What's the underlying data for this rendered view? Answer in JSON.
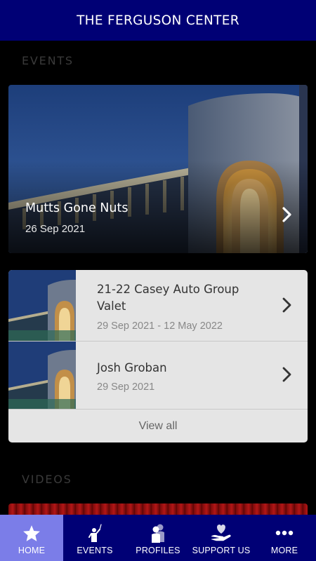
{
  "header": {
    "title": "THE FERGUSON CENTER"
  },
  "sections": {
    "events": "EVENTS",
    "videos": "VIDEOS"
  },
  "featured_event": {
    "title": "Mutts Gone Nuts",
    "date": "26 Sep 2021"
  },
  "event_list": {
    "items": [
      {
        "title_line1": "21-22 Casey Auto Group",
        "title_line2": "Valet",
        "date": "29 Sep 2021 - 12 May 2022"
      },
      {
        "title_line1": "Josh Groban",
        "date": "29 Sep 2021"
      }
    ],
    "view_all": "View all"
  },
  "tabbar": {
    "active": "home",
    "items": [
      {
        "label": "HOME",
        "icon": "star-icon"
      },
      {
        "label": "EVENTS",
        "icon": "conductor-icon"
      },
      {
        "label": "PROFILES",
        "icon": "people-icon"
      },
      {
        "label": "SUPPORT US",
        "icon": "heart-hand-icon"
      },
      {
        "label": "MORE",
        "icon": "dots-icon"
      }
    ]
  },
  "colors": {
    "header_bg": "#000075",
    "active_tab": "#7b7de8",
    "card_bg": "#e5e5e5"
  }
}
